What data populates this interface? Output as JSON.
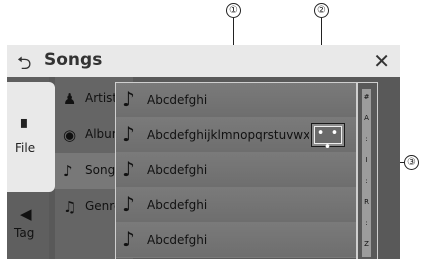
{
  "callouts": [
    "①",
    "②",
    "③"
  ],
  "header": {
    "back_icon": "back-arrow-icon",
    "back_glyph": "⮌",
    "title": "Songs",
    "close_glyph": "✕"
  },
  "tabs": [
    {
      "label": "File",
      "icon": "file-icon",
      "glyph": "▘",
      "selected": true
    },
    {
      "label": "Tag",
      "icon": "tag-icon",
      "glyph": "◀",
      "selected": false
    }
  ],
  "categories": [
    {
      "label": "Artists",
      "icon": "person-icon",
      "glyph": "♟"
    },
    {
      "label": "Albums",
      "icon": "disc-icon",
      "glyph": "◉"
    },
    {
      "label": "Songs",
      "icon": "music-note-icon",
      "glyph": "♪",
      "selected": true
    },
    {
      "label": "Genres",
      "icon": "guitar-icon",
      "glyph": "♫"
    }
  ],
  "songs": [
    {
      "title": "Abcdefghi",
      "icon": "music-note-icon",
      "glyph": "♪"
    },
    {
      "title": "Abcdefghijklmnopqrstuvwxyz",
      "icon": "music-note-icon",
      "glyph": "♪",
      "more": "• • •"
    },
    {
      "title": "Abcdefghi",
      "icon": "music-note-icon",
      "glyph": "♪"
    },
    {
      "title": "Abcdefghi",
      "icon": "music-note-icon",
      "glyph": "♪"
    },
    {
      "title": "Abcdefghi",
      "icon": "music-note-icon",
      "glyph": "♪"
    }
  ],
  "index_labels": [
    "#",
    "A",
    ":",
    "I",
    ":",
    "R",
    ":",
    "Z"
  ]
}
